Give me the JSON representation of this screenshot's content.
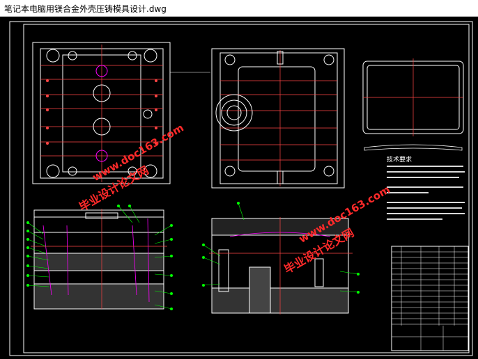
{
  "window": {
    "title": "笔记本电脑用镁合金外壳压铸模具设计.dwg"
  },
  "drawing": {
    "watermarks": [
      "毕业设计论文网",
      "www.doc163.com"
    ],
    "notes_title": "技术要求",
    "colors": {
      "background": "#000000",
      "outline": "#ffffff",
      "centerline": "#ff0000",
      "leader": "#00ff00",
      "hatch": "#ff00ff",
      "watermark": "#ff0000",
      "frame": "#ffffff"
    }
  }
}
